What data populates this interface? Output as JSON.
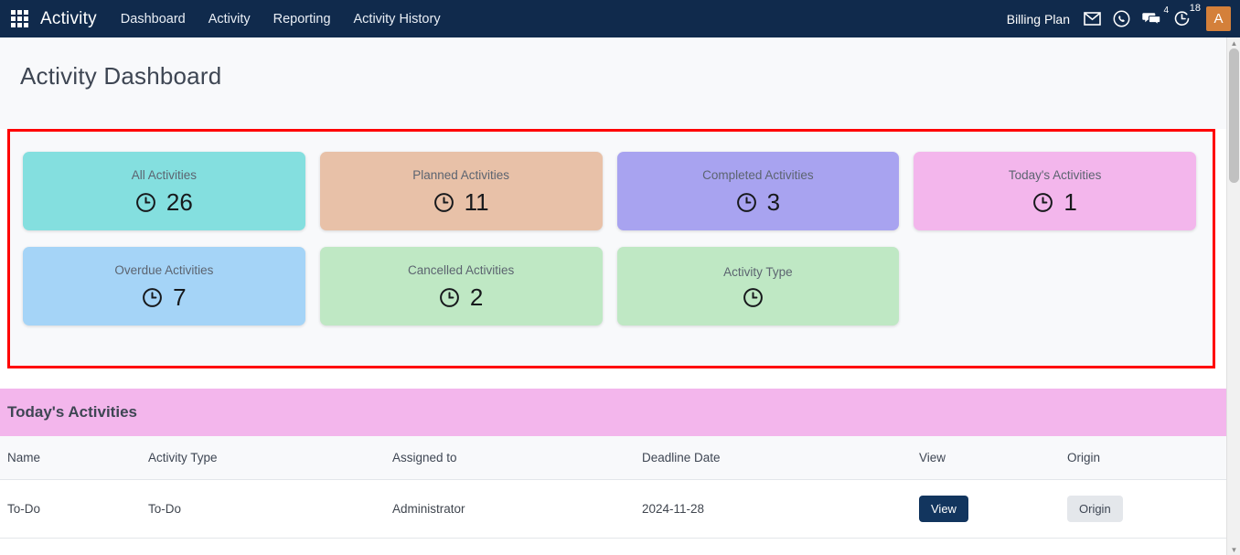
{
  "topbar": {
    "app_grid_icon": "apps-grid-icon",
    "brand": "Activity",
    "nav": [
      {
        "label": "Dashboard"
      },
      {
        "label": "Activity"
      },
      {
        "label": "Reporting"
      },
      {
        "label": "Activity History"
      }
    ],
    "billing_label": "Billing Plan",
    "icons": [
      {
        "name": "mail-icon",
        "badge": ""
      },
      {
        "name": "whatsapp-icon",
        "badge": ""
      },
      {
        "name": "chat-icon",
        "badge": "4"
      },
      {
        "name": "activity-timer-icon",
        "badge": "18"
      }
    ],
    "avatar_initial": "A",
    "background_color": "#102a4c",
    "avatar_color": "#d4803a"
  },
  "page": {
    "title": "Activity Dashboard",
    "highlight_border_color": "#ff0000"
  },
  "kpi_cards": [
    {
      "label": "All Activities",
      "value": "26",
      "color": "#84dfdf",
      "icon": "clock-icon"
    },
    {
      "label": "Planned Activities",
      "value": "11",
      "color": "#e8c1a8",
      "icon": "clock-icon"
    },
    {
      "label": "Completed Activities",
      "value": "3",
      "color": "#a8a3f0",
      "icon": "clock-icon"
    },
    {
      "label": "Today's Activities",
      "value": "1",
      "color": "#f3b6ec",
      "icon": "clock-icon"
    },
    {
      "label": "Overdue Activities",
      "value": "7",
      "color": "#a5d4f7",
      "icon": "clock-icon"
    },
    {
      "label": "Cancelled Activities",
      "value": "2",
      "color": "#bfe8c4",
      "icon": "clock-icon"
    },
    {
      "label": "Activity Type",
      "value": "",
      "color": "#bfe8c4",
      "icon": "clock-icon"
    }
  ],
  "todays_activities": {
    "section_title": "Today's Activities",
    "band_color": "#f3b6ec",
    "columns": [
      "Name",
      "Activity Type",
      "Assigned to",
      "Deadline Date",
      "View",
      "Origin"
    ],
    "rows": [
      {
        "name": "To-Do",
        "activity_type": "To-Do",
        "assigned_to": "Administrator",
        "deadline_date": "2024-11-28",
        "view_label": "View",
        "origin_label": "Origin"
      }
    ]
  },
  "scrollbar": {
    "up_arrow": "▲",
    "down_arrow": "▼"
  }
}
